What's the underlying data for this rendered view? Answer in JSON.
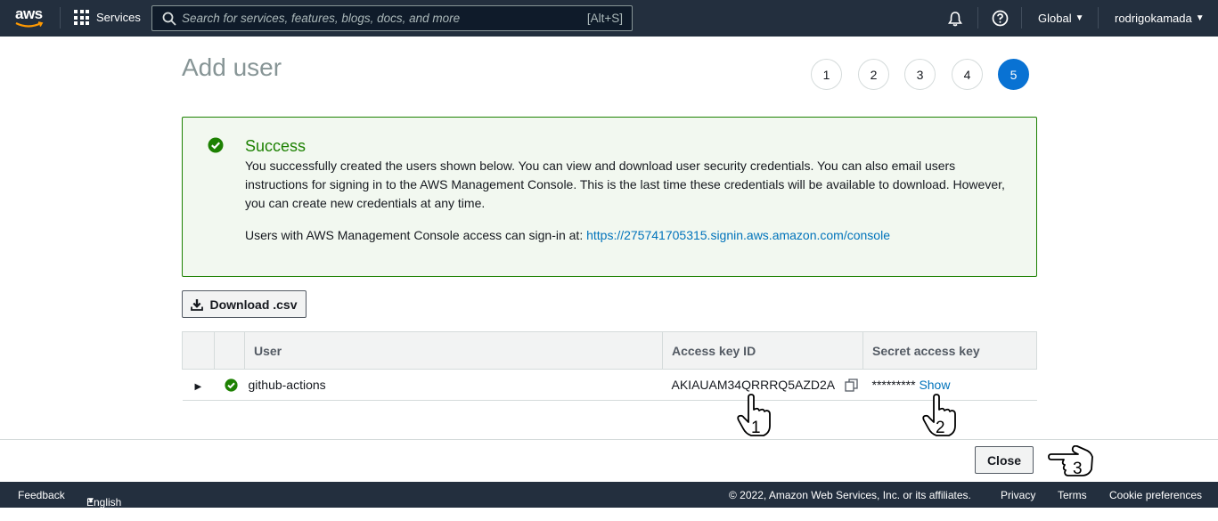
{
  "topnav": {
    "logo_text": "aws",
    "services_label": "Services",
    "search_placeholder": "Search for services, features, blogs, docs, and more",
    "search_shortcut": "[Alt+S]",
    "region": "Global",
    "account": "rodrigokamada"
  },
  "page": {
    "title": "Add user",
    "steps": [
      "1",
      "2",
      "3",
      "4",
      "5"
    ],
    "active_step": "5"
  },
  "alert": {
    "title": "Success",
    "message": "You successfully created the users shown below. You can view and download user security credentials. You can also email users instructions for signing in to the AWS Management Console. This is the last time these credentials will be available to download. However, you can create new credentials at any time.",
    "signin_text": "Users with AWS Management Console access can sign-in at: ",
    "signin_url": "https://275741705315.signin.aws.amazon.com/console"
  },
  "download_label": "Download .csv",
  "table": {
    "headers": [
      "User",
      "Access key ID",
      "Secret access key"
    ],
    "rows": [
      {
        "user": "github-actions",
        "access_key_id": "AKIAUAM34QRRRQ5AZD2A",
        "secret_masked": "*********",
        "show_label": "Show"
      }
    ]
  },
  "close_label": "Close",
  "annotations": [
    "1",
    "2",
    "3"
  ],
  "footer": {
    "feedback": "Feedback",
    "language": "English (US)",
    "copyright": "© 2022, Amazon Web Services, Inc. or its affiliates.",
    "privacy": "Privacy",
    "terms": "Terms",
    "cookies": "Cookie preferences"
  },
  "colors": {
    "nav_bg": "#232f3e",
    "success": "#1d8102",
    "link": "#0073bb",
    "active_step": "#0972d3"
  }
}
